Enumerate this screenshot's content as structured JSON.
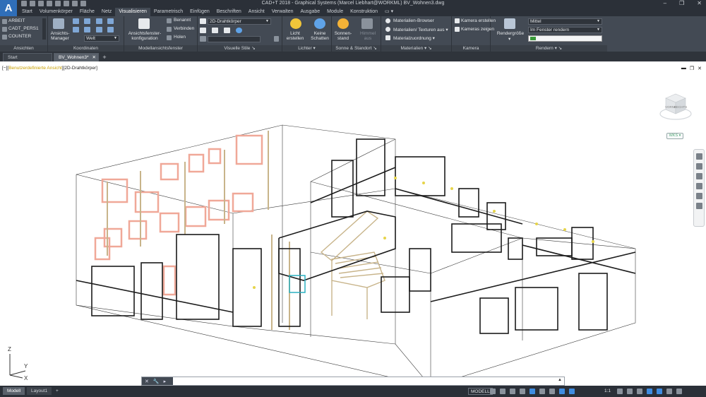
{
  "window": {
    "title": "CAD+T 2018 - Graphical Systems  (Marcel Liebhart@WORKML)   BV_Wohnen3.dwg",
    "app_logo": "A"
  },
  "ribbon_tabs": [
    "Start",
    "Volumenkörper",
    "Fläche",
    "Netz",
    "Visualisieren",
    "Parametrisch",
    "Einfügen",
    "Beschriften",
    "Ansicht",
    "Verwalten",
    "Ausgabe",
    "Module",
    "Konstruktion"
  ],
  "active_tab": "Visualisieren",
  "ribbon": {
    "ansichten": {
      "title": "Ansichten",
      "items": [
        "ARBEIT",
        "CADT_PERS1",
        "COUNTER"
      ]
    },
    "koordinaten": {
      "title": "Koordinaten",
      "ansichtsmanager": "Ansichts-Manager",
      "welt": "Welt"
    },
    "modellansichtsfenster": {
      "title": "Modellansichtsfenster",
      "konfiguration": "Ansichtsfenster-konfiguration",
      "benannt": "Benannt",
      "verbinden": "Verbinden",
      "holen": "Holen"
    },
    "visuelle_stile": {
      "title": "Visuelle Stile",
      "style": "2D-Drahtkörper"
    },
    "lichter": {
      "title": "Lichter",
      "licht_erstellen": "Licht erstellen",
      "keine_schatten": "Keine Schatten"
    },
    "sonne": {
      "title": "Sonne & Standort",
      "sonnenstand": "Sonnen-stand",
      "himmel_aus": "Himmel aus"
    },
    "materialien": {
      "title": "Materialien",
      "browser": "Materialien-Browser",
      "texturen": "Materialien/ Texturen aus",
      "zuordnung": "Materialzuordnung"
    },
    "kamera": {
      "title": "Kamera",
      "erstellen": "Kamera erstellen",
      "zeigen": "Kameras  zeigen"
    },
    "rendern": {
      "title": "Rendern",
      "rendergroesse": "Rendergröße",
      "quality": "Mittel",
      "target": "Im Fenster rendern"
    }
  },
  "doc_tabs": [
    "Start",
    "BV_Wohnen3*"
  ],
  "viewport": {
    "label_prefix": "[−][",
    "label_view": "Benutzerdefinierte Ansicht",
    "label_style": "][2D-Drahtkörper]",
    "viewcube_front": "VORNE",
    "viewcube_right": "RECHTS",
    "wcs": "WKS",
    "ucs_x": "X",
    "ucs_y": "Y",
    "ucs_z": "Z"
  },
  "command_line": {
    "value": ""
  },
  "status_bar": {
    "layout_tabs": [
      "Modell",
      "Layout1"
    ],
    "mode": "MODELL",
    "scale": "1:1"
  },
  "colors": {
    "ribbon_bg": "#434a54",
    "title_bg": "#2b3038",
    "salmon": "#f0a898",
    "tan": "#c8b48a",
    "teal": "#2ab0c0",
    "accent_blue": "#3f8ce0"
  }
}
